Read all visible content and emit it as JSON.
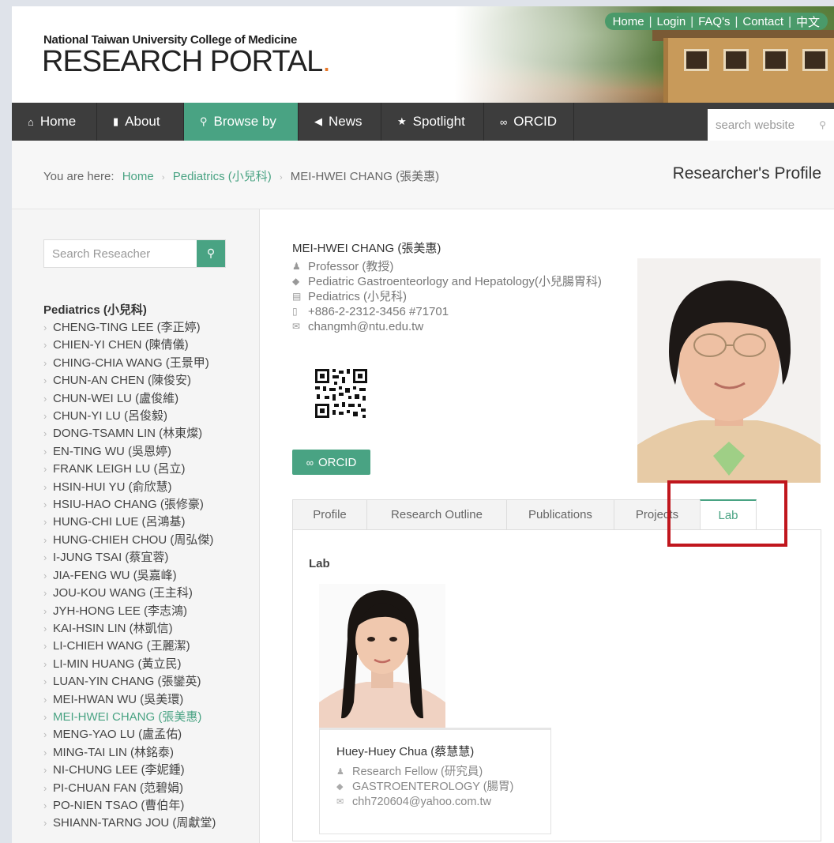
{
  "header": {
    "brand_small": "National Taiwan University College of Medicine",
    "brand_big": "RESEARCH PORTAL",
    "brand_dot": ".",
    "toplinks": [
      "Home",
      "Login",
      "FAQ's",
      "Contact",
      "中文"
    ]
  },
  "nav": {
    "items": [
      {
        "label": "Home",
        "icon": "home-icon"
      },
      {
        "label": "About",
        "icon": "document-icon"
      },
      {
        "label": "Browse by",
        "icon": "search-icon"
      },
      {
        "label": "News",
        "icon": "megaphone-icon"
      },
      {
        "label": "Spotlight",
        "icon": "star-icon"
      },
      {
        "label": "ORCID",
        "icon": "link-icon"
      }
    ],
    "active": "Browse by",
    "search_placeholder": "search website"
  },
  "breadcrumb": {
    "prefix": "You are here:",
    "items": [
      "Home",
      "Pediatrics (小兒科)",
      "MEI-HWEI CHANG (張美惠)"
    ],
    "page_title": "Researcher's Profile"
  },
  "sidebar": {
    "search_placeholder": "Search Reseacher",
    "department": "Pediatrics (小兒科)",
    "researchers": [
      "CHENG-TING LEE (李正婷)",
      "CHIEN-YI CHEN (陳倩儀)",
      "CHING-CHIA WANG (王景甲)",
      "CHUN-AN CHEN (陳俊安)",
      "CHUN-WEI LU (盧俊維)",
      "CHUN-YI LU (呂俊毅)",
      "DONG-TSAMN LIN (林東燦)",
      "EN-TING WU (吳恩婷)",
      "FRANK LEIGH LU (呂立)",
      "HSIN-HUI YU (俞欣慧)",
      "HSIU-HAO CHANG (張修豪)",
      "HUNG-CHI LUE (呂鴻基)",
      "HUNG-CHIEH CHOU (周弘傑)",
      "I-JUNG TSAI (蔡宜蓉)",
      "JIA-FENG WU (吳嘉峰)",
      "JOU-KOU WANG (王主科)",
      "JYH-HONG LEE (李志鴻)",
      "KAI-HSIN LIN (林凱信)",
      "LI-CHIEH WANG (王麗潔)",
      "LI-MIN HUANG (黃立民)",
      "LUAN-YIN CHANG (張鑾英)",
      "MEI-HWAN WU (吳美環)",
      "MEI-HWEI CHANG (張美惠)",
      "MENG-YAO LU (盧孟佑)",
      "MING-TAI LIN (林銘泰)",
      "NI-CHUNG LEE (李妮鍾)",
      "PI-CHUAN FAN (范碧娟)",
      "PO-NIEN TSAO (曹伯年)",
      "SHIANN-TARNG JOU (周獻堂)"
    ],
    "current": "MEI-HWEI CHANG (張美惠)"
  },
  "profile": {
    "name": "MEI-HWEI CHANG (張美惠)",
    "title": "Professor (教授)",
    "specialty": "Pediatric Gastroenteorlogy and Hepatology(小兒腸胃科)",
    "department": "Pediatrics (小兒科)",
    "phone": "+886-2-2312-3456 #71701",
    "email": "changmh@ntu.edu.tw",
    "orcid_label": "ORCID"
  },
  "tabs": {
    "items": [
      "Profile",
      "Research Outline",
      "Publications",
      "Projects",
      "Lab"
    ],
    "active": "Lab"
  },
  "lab": {
    "heading": "Lab",
    "member": {
      "name": "Huey-Huey Chua (蔡慧慧)",
      "role": "Research Fellow (研究員)",
      "field": "GASTROENTEROLOGY (腸胃)",
      "email": "chh720604@yahoo.com.tw"
    }
  },
  "colors": {
    "accent": "#49a383",
    "nav_bg": "#3d3d3d",
    "highlight_box": "#c0161d"
  }
}
